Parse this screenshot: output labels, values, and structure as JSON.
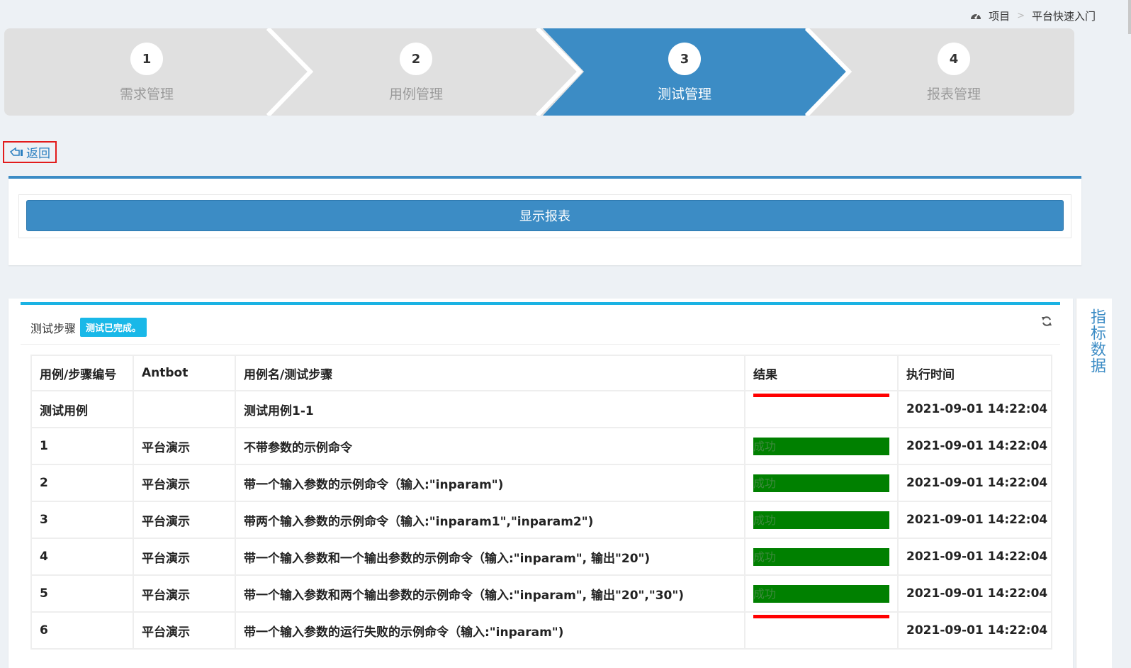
{
  "breadcrumb": {
    "items": [
      "项目",
      "平台快速入门"
    ],
    "separator": ">"
  },
  "wizard": {
    "steps": [
      {
        "number": "1",
        "label": "需求管理"
      },
      {
        "number": "2",
        "label": "用例管理"
      },
      {
        "number": "3",
        "label": "测试管理"
      },
      {
        "number": "4",
        "label": "报表管理"
      }
    ],
    "active_index": 2,
    "active_color": "#3c8cc5",
    "inactive_color": "#e0e0e0"
  },
  "back_link": {
    "label": "返回"
  },
  "report_panel": {
    "show_report_label": "显示报表"
  },
  "steps_panel": {
    "title": "测试步骤",
    "status": "测试已完成。",
    "table": {
      "headers": [
        "用例/步骤编号",
        "Antbot",
        "用例名/测试步骤",
        "结果",
        "执行时间"
      ],
      "rows": [
        {
          "id": "测试用例",
          "antbot": "",
          "name": "测试用例1-1",
          "result": "",
          "result_status": "red",
          "time": "2021-09-01 14:22:04"
        },
        {
          "id": "1",
          "antbot": "平台演示",
          "name": "不带参数的示例命令",
          "result": "成功",
          "result_status": "green",
          "time": "2021-09-01 14:22:04"
        },
        {
          "id": "2",
          "antbot": "平台演示",
          "name": "带一个输入参数的示例命令（输入:\"inparam\")",
          "result": "成功",
          "result_status": "green",
          "time": "2021-09-01 14:22:04"
        },
        {
          "id": "3",
          "antbot": "平台演示",
          "name": "带两个输入参数的示例命令（输入:\"inparam1\",\"inparam2\")",
          "result": "成功",
          "result_status": "green",
          "time": "2021-09-01 14:22:04"
        },
        {
          "id": "4",
          "antbot": "平台演示",
          "name": "带一个输入参数和一个输出参数的示例命令（输入:\"inparam\", 输出\"20\")",
          "result": "成功",
          "result_status": "green",
          "time": "2021-09-01 14:22:04"
        },
        {
          "id": "5",
          "antbot": "平台演示",
          "name": "带一个输入参数和两个输出参数的示例命令（输入:\"inparam\", 输出\"20\",\"30\")",
          "result": "成功",
          "result_status": "green",
          "time": "2021-09-01 14:22:04"
        },
        {
          "id": "6",
          "antbot": "平台演示",
          "name": "带一个输入参数的运行失败的示例命令（输入:\"inparam\")",
          "result": "",
          "result_status": "red",
          "time": "2021-09-01 14:22:04"
        }
      ]
    }
  },
  "side_tab": {
    "label": "指标数据"
  }
}
